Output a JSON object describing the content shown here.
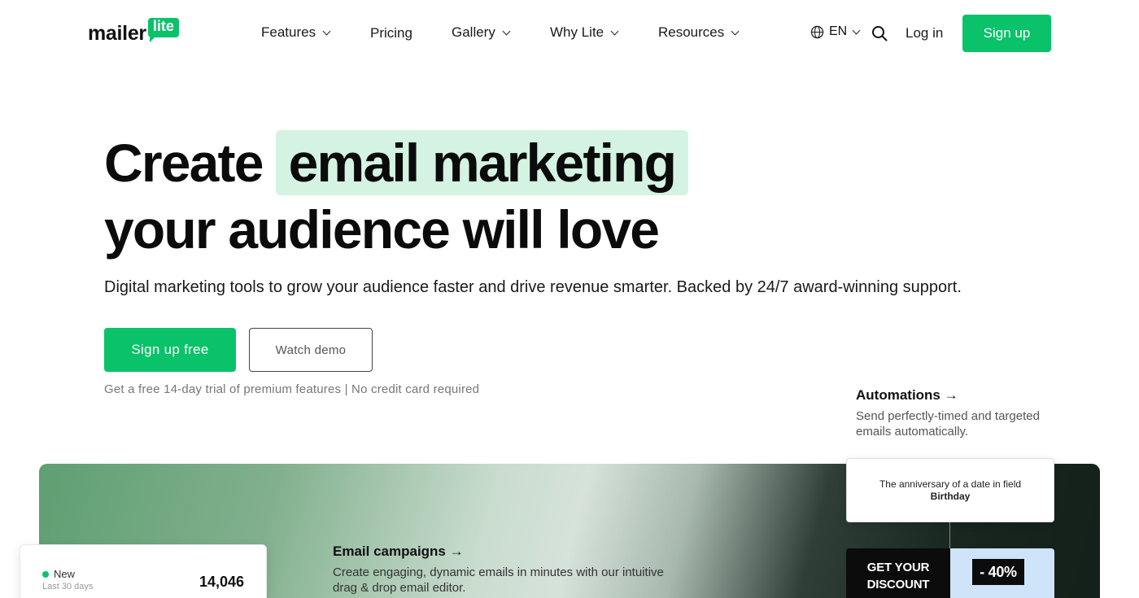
{
  "header": {
    "logo": {
      "word": "mailer",
      "badge": "lite"
    },
    "nav": [
      {
        "label": "Features",
        "has_dropdown": true
      },
      {
        "label": "Pricing",
        "has_dropdown": false
      },
      {
        "label": "Gallery",
        "has_dropdown": true
      },
      {
        "label": "Why Lite",
        "has_dropdown": true
      },
      {
        "label": "Resources",
        "has_dropdown": true
      }
    ],
    "language": "EN",
    "search_icon": "search-icon",
    "login_label": "Log in",
    "signup_label": "Sign up"
  },
  "hero": {
    "title_plain": "Create",
    "title_highlight": "email marketing",
    "title_line2": "your audience will love",
    "subtitle": "Digital marketing tools to grow your audience faster and drive revenue smarter. Backed by 24/7 award-winning support.",
    "primary_cta": "Sign up free",
    "secondary_cta": "Watch demo",
    "trial_note": "Get a free 14-day trial of premium features | No credit card required"
  },
  "features": {
    "automations": {
      "title": "Automations →",
      "description": "Send perfectly-timed and targeted emails automatically."
    },
    "email_campaigns": {
      "title": "Email campaigns →",
      "description": "Create engaging, dynamic emails in minutes with our intuitive drag & drop email editor."
    }
  },
  "stats_card": {
    "label": "New",
    "sublabel": "Last 30 days",
    "value": "14,046"
  },
  "automation_card": {
    "text": "The anniversary of a date in field",
    "field": "Birthday"
  },
  "promo": {
    "line1": "GET YOUR",
    "line2": "DISCOUNT",
    "tag": "- 40%"
  },
  "colors": {
    "brand_green": "#09c269",
    "highlight": "#d4f3e2",
    "promo_blue": "#cfe3f9"
  }
}
